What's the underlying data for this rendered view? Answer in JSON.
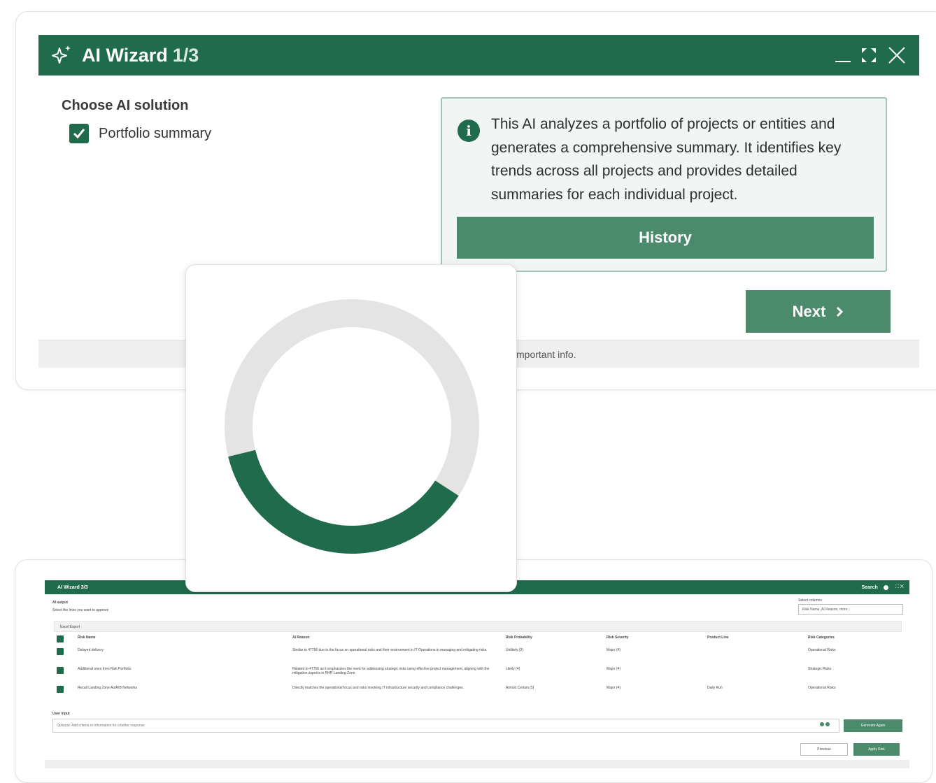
{
  "wizard": {
    "title": "AI Wizard",
    "step": "1/3",
    "choose_label": "Choose AI solution",
    "option_label": "Portfolio summary",
    "option_checked": true,
    "info_text": "This AI analyzes a portfolio of projects or entities and generates a comprehensive summary. It identifies key trends across all projects and provides detailed summaries for each individual project.",
    "history_label": "History",
    "next_label": "Next",
    "footer_text": "mportant info."
  },
  "loading": {
    "progress_fraction": 0.37,
    "colors": {
      "progress": "#1f6b4c",
      "track": "#e4e4e4"
    }
  },
  "background_panel": {
    "title": "AI Wizard 3/3",
    "search_label": "Search",
    "section_title": "AI output",
    "section_subtitle": "Select the lines you want to approve",
    "display_label": "Select columns",
    "display_value": "Risk Name, AI Reason, more...",
    "export_label": "Excel Export",
    "columns": [
      "Risk Name",
      "AI Reason",
      "Risk Probability",
      "Risk Severity",
      "Product Line",
      "Risk Categories"
    ],
    "rows": [
      [
        "Delayed delivery",
        "Similar to 47756 due to the focus on operational risks and their environment in IT Operations in managing and mitigating risks.",
        "Unlikely (2)",
        "Major (4)",
        "",
        "Operational Risks"
      ],
      [
        "Additional ones from Risk Portfolio",
        "Related to 47756 as it emphasizes the need for addressing strategic risks using effective project management, aligning with the mitigation aspects in RHR Landing Zone.",
        "Likely (4)",
        "Major (4)",
        "",
        "Strategic Risks"
      ],
      [
        "Recall Landing Zone AutRIB Networks",
        "Directly matches the operational focus and risks involving IT infrastructure security and compliance challenges.",
        "Almost Certain (5)",
        "Major (4)",
        "Daily Run",
        "Operational Risks"
      ]
    ],
    "user_input_label": "User input",
    "user_input_placeholder": "Optional: Add criteria or information for a better response",
    "generate_label": "Generate Again",
    "previous_label": "Previous",
    "apply_label": "Apply Risk"
  },
  "colors": {
    "brand": "#1f6b4c",
    "button": "#4c8a6c",
    "info_bg": "#f1f5f3",
    "info_border": "#a3c6b4"
  }
}
